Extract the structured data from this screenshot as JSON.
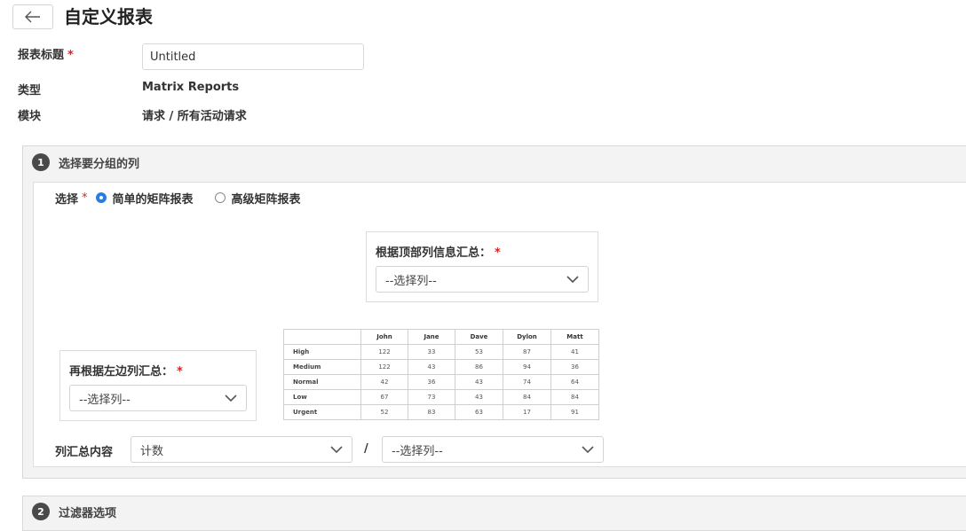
{
  "header": {
    "back_icon": "arrow-left-icon",
    "title": "自定义报表"
  },
  "form": {
    "report_title_label": "报表标题",
    "required_mark": "*",
    "report_title_value": "Untitled",
    "type_label": "类型",
    "type_value": "Matrix Reports",
    "module_label": "模块",
    "module_value": "请求 / 所有活动请求"
  },
  "section1": {
    "number": "1",
    "title": "选择要分组的列",
    "select_label": "选择",
    "options": [
      {
        "label": "简单的矩阵报表",
        "checked": true
      },
      {
        "label": "高级矩阵报表",
        "checked": false
      }
    ],
    "top_group": {
      "label": "根据顶部列信息汇总：",
      "value": "--选择列--"
    },
    "left_group": {
      "label": "再根据左边列汇总：",
      "value": "--选择列--"
    },
    "summary": {
      "label": "列汇总内容",
      "value1": "计数",
      "separator": "/",
      "value2": "--选择列--"
    },
    "preview": {
      "columns": [
        "",
        "John",
        "Jane",
        "Dave",
        "Dylon",
        "Matt"
      ],
      "rows": [
        {
          "label": "High",
          "values": [
            "122",
            "33",
            "53",
            "87",
            "41"
          ]
        },
        {
          "label": "Medium",
          "values": [
            "122",
            "43",
            "86",
            "94",
            "36"
          ]
        },
        {
          "label": "Normal",
          "values": [
            "42",
            "36",
            "43",
            "74",
            "64"
          ]
        },
        {
          "label": "Low",
          "values": [
            "67",
            "73",
            "43",
            "84",
            "84"
          ]
        },
        {
          "label": "Urgent",
          "values": [
            "52",
            "83",
            "63",
            "17",
            "91"
          ]
        }
      ]
    }
  },
  "section2": {
    "number": "2",
    "title": "过滤器选项"
  },
  "colors": {
    "accent": "#2a7de1",
    "required": "#e02020",
    "step_badge": "#4a4a4a"
  }
}
